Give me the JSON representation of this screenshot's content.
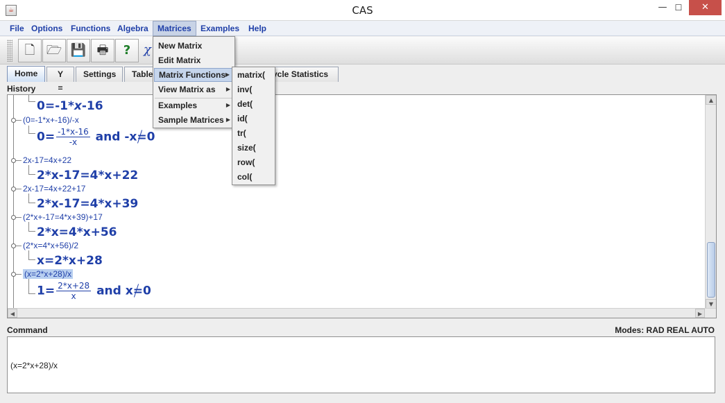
{
  "window": {
    "title": "CAS",
    "icon": "java-icon",
    "minimize_glyph": "—",
    "maximize_glyph": "☐",
    "close_glyph": "✕"
  },
  "menubar": {
    "items": [
      {
        "label": "File"
      },
      {
        "label": "Options"
      },
      {
        "label": "Functions"
      },
      {
        "label": "Algebra"
      },
      {
        "label": "Matrices"
      },
      {
        "label": "Examples"
      },
      {
        "label": "Help"
      }
    ]
  },
  "toolbar": {
    "buttons": [
      {
        "icon": "new-file-icon",
        "glyph": "🗋"
      },
      {
        "icon": "open-folder-icon",
        "glyph": "🗁"
      },
      {
        "icon": "save-icon",
        "glyph": "💾"
      },
      {
        "icon": "print-icon",
        "glyph": "🖶"
      },
      {
        "icon": "help-icon",
        "glyph": "?"
      }
    ],
    "partial_glyph": "χ"
  },
  "tabs": [
    {
      "label": "Home"
    },
    {
      "label": "Y ="
    },
    {
      "label": "Settings"
    },
    {
      "label": "Table"
    },
    {
      "label": "ycle Statistics"
    }
  ],
  "history": {
    "label": "History",
    "entries": [
      {
        "input": "",
        "output_lhs": "0=-1*",
        "output_var": "x",
        "output_rhs": "-16"
      },
      {
        "input": "(0=-1*x+-16)/-x",
        "output_lhs": "0=",
        "frac_num": "-1*x-16",
        "frac_den": "-x",
        "output_tail": "and -x",
        "neq_value": "0"
      },
      {
        "input": "2x-17=4x+22",
        "output_text": "2*x-17=4*x+22"
      },
      {
        "input": "2x-17=4x+22+17",
        "output_text": "2*x-17=4*x+39"
      },
      {
        "input": "(2*x+-17=4*x+39)+17",
        "output_text": "2*x=4*x+56"
      },
      {
        "input": "(2*x=4*x+56)/2",
        "output_text": "x=2*x+28"
      },
      {
        "input": "(x=2*x+28)/x",
        "output_lhs": "1=",
        "frac_num": "2*x+28",
        "frac_den": "x",
        "output_tail": "and x",
        "neq_value": "0"
      }
    ]
  },
  "command": {
    "label": "Command",
    "modes": "Modes: RAD REAL AUTO",
    "value": "(x=2*x+28)/x"
  },
  "matrices_menu": {
    "items": [
      {
        "label": "New Matrix"
      },
      {
        "label": "Edit Matrix"
      },
      {
        "label": "Matrix Functions"
      },
      {
        "label": "View Matrix as"
      },
      {
        "label": "Examples"
      },
      {
        "label": "Sample Matrices"
      }
    ]
  },
  "matrix_functions_menu": {
    "items": [
      {
        "label": "matrix("
      },
      {
        "label": "inv("
      },
      {
        "label": "det("
      },
      {
        "label": "id("
      },
      {
        "label": "tr("
      },
      {
        "label": "size("
      },
      {
        "label": "row("
      },
      {
        "label": "col("
      }
    ]
  }
}
